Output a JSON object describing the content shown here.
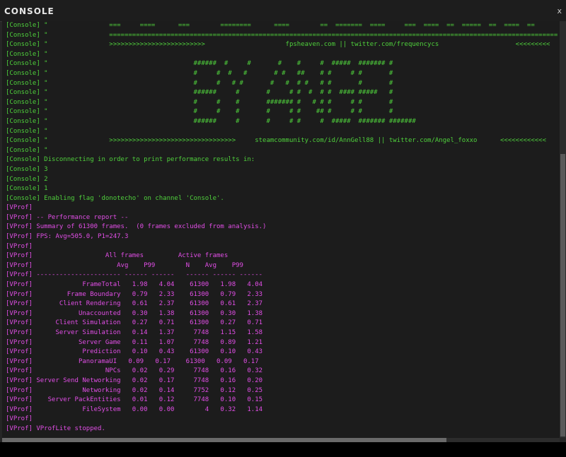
{
  "window": {
    "title": "CONSOLE",
    "close_label": "x"
  },
  "colors": {
    "console_tag": "#4fd03c",
    "vprof_tag": "#e14ee6",
    "background": "#1c1c1c"
  },
  "console": {
    "lines": [
      {
        "color": "green",
        "text": "[Console] \"                ===     ====      ===        ========      ====        ==  =======  ====     ===  ====  ==  =====  ==  ====  =="
      },
      {
        "color": "green",
        "text": "[Console] \"                ====================================================================================================================="
      },
      {
        "color": "green",
        "text": "[Console] \"                >>>>>>>>>>>>>>>>>>>>>>>>>                     fpsheaven.com || twitter.com/frequencycs                    <<<<<<<<<"
      },
      {
        "color": "green",
        "text": "[Console] \""
      },
      {
        "color": "green",
        "text": "[Console] \"                                      ######  #     #       #    #     #  #####  ####### #"
      },
      {
        "color": "green",
        "text": "[Console] \"                                      #     #  #   #       # #   ##    # #     # #       #"
      },
      {
        "color": "green",
        "text": "[Console] \"                                      #     #   # #       #   #  # #   # #       #       #"
      },
      {
        "color": "green",
        "text": "[Console] \"                                      ######     #       #     # #  #  # #  #### #####   #"
      },
      {
        "color": "green",
        "text": "[Console] \"                                      #     #    #       ####### #   # # #     # #       #"
      },
      {
        "color": "green",
        "text": "[Console] \"                                      #     #    #       #     # #    ## #     # #       #"
      },
      {
        "color": "green",
        "text": "[Console] \"                                      ######     #       #     # #     #  #####  ####### #######"
      },
      {
        "color": "green",
        "text": "[Console] \""
      },
      {
        "color": "green",
        "text": "[Console] \"                >>>>>>>>>>>>>>>>>>>>>>>>>>>>>>>>>     steamcommunity.com/id/AnnGell88 || twitter.com/Angel_foxxo      <<<<<<<<<<<<"
      },
      {
        "color": "green",
        "text": "[Console] \""
      },
      {
        "color": "green",
        "text": "[Console] Disconnecting in order to print performance results in:"
      },
      {
        "color": "green",
        "text": "[Console] 3"
      },
      {
        "color": "green",
        "text": "[Console] 2"
      },
      {
        "color": "green",
        "text": "[Console] 1"
      },
      {
        "color": "green",
        "text": "[Console] Enabling flag 'donotecho' on channel 'Console'."
      },
      {
        "color": "magenta",
        "text": "[VProf]"
      },
      {
        "color": "magenta",
        "text": "[VProf] -- Performance report --"
      },
      {
        "color": "magenta",
        "text": "[VProf] Summary of 61300 frames.  (0 frames excluded from analysis.)"
      },
      {
        "color": "magenta",
        "text": "[VProf] FPS: Avg=505.0, P1=247.3"
      },
      {
        "color": "magenta",
        "text": "[VProf]"
      },
      {
        "color": "magenta",
        "text": "[VProf]                   All frames         Active frames"
      },
      {
        "color": "magenta",
        "text": "[VProf]                      Avg    P99        N    Avg    P99"
      },
      {
        "color": "magenta",
        "text": "[VProf] ---------------------- ------ ------   ------ ------ ------"
      },
      {
        "color": "magenta",
        "text": "[VProf]             FrameTotal   1.98   4.04    61300   1.98   4.04"
      },
      {
        "color": "magenta",
        "text": "[VProf]         Frame Boundary   0.79   2.33    61300   0.79   2.33"
      },
      {
        "color": "magenta",
        "text": "[VProf]       Client Rendering   0.61   2.37    61300   0.61   2.37"
      },
      {
        "color": "magenta",
        "text": "[VProf]            Unaccounted   0.30   1.38    61300   0.30   1.38"
      },
      {
        "color": "magenta",
        "text": "[VProf]      Client Simulation   0.27   0.71    61300   0.27   0.71"
      },
      {
        "color": "magenta",
        "text": "[VProf]      Server Simulation   0.14   1.37     7748   1.15   1.58"
      },
      {
        "color": "magenta",
        "text": "[VProf]            Server Game   0.11   1.07     7748   0.89   1.21"
      },
      {
        "color": "magenta",
        "text": "[VProf]             Prediction   0.10   0.43    61300   0.10   0.43"
      },
      {
        "color": "magenta",
        "text": "[VProf]            PanoramaUI   0.09   0.17    61300   0.09   0.17"
      },
      {
        "color": "magenta",
        "text": "[VProf]                   NPCs   0.02   0.29     7748   0.16   0.32"
      },
      {
        "color": "magenta",
        "text": "[VProf] Server Send Networking   0.02   0.17     7748   0.16   0.20"
      },
      {
        "color": "magenta",
        "text": "[VProf]             Networking   0.02   0.14     7752   0.12   0.25"
      },
      {
        "color": "magenta",
        "text": "[VProf]    Server PackEntities   0.01   0.12     7748   0.10   0.15"
      },
      {
        "color": "magenta",
        "text": "[VProf]             FileSystem   0.00   0.00        4   0.32   1.14"
      },
      {
        "color": "magenta",
        "text": "[VProf]"
      },
      {
        "color": "magenta",
        "text": "[VProf] VProfLite stopped."
      }
    ]
  },
  "input": {
    "value": "",
    "placeholder": ""
  }
}
